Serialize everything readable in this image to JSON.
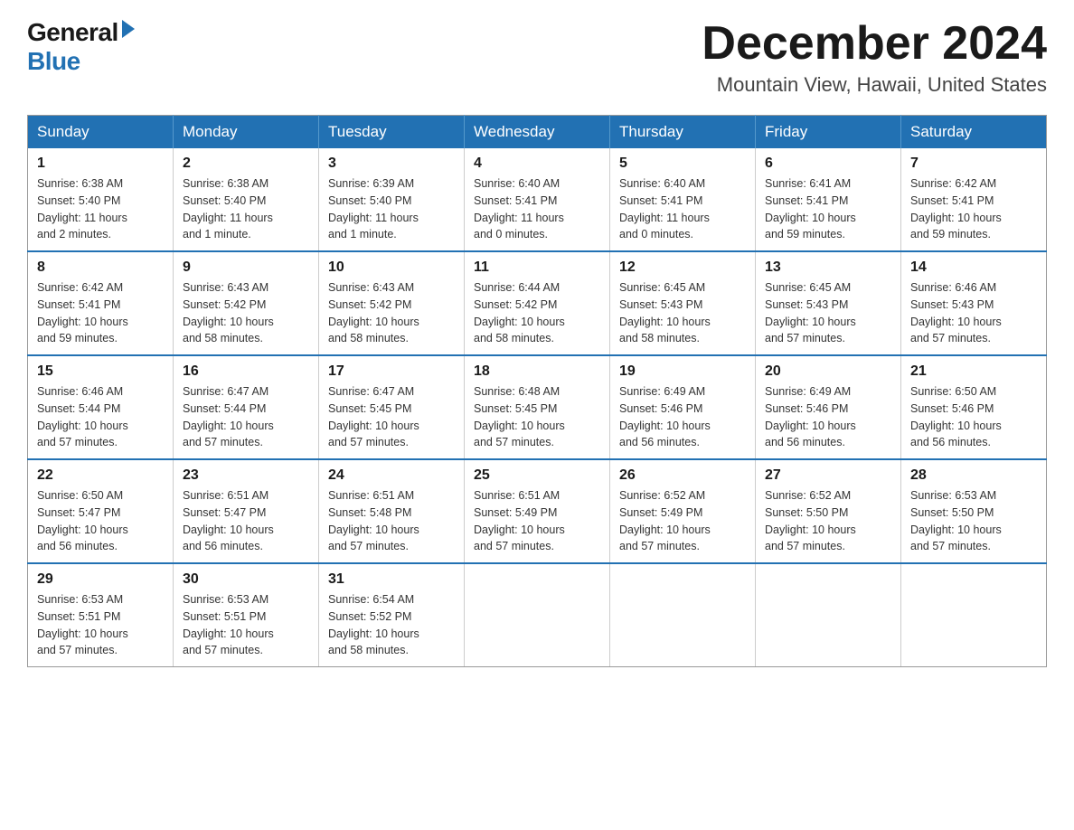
{
  "header": {
    "logo": {
      "general": "General",
      "blue": "Blue"
    },
    "title": "December 2024",
    "location": "Mountain View, Hawaii, United States"
  },
  "calendar": {
    "days_of_week": [
      "Sunday",
      "Monday",
      "Tuesday",
      "Wednesday",
      "Thursday",
      "Friday",
      "Saturday"
    ],
    "weeks": [
      [
        {
          "day": 1,
          "info": "Sunrise: 6:38 AM\nSunset: 5:40 PM\nDaylight: 11 hours\nand 2 minutes."
        },
        {
          "day": 2,
          "info": "Sunrise: 6:38 AM\nSunset: 5:40 PM\nDaylight: 11 hours\nand 1 minute."
        },
        {
          "day": 3,
          "info": "Sunrise: 6:39 AM\nSunset: 5:40 PM\nDaylight: 11 hours\nand 1 minute."
        },
        {
          "day": 4,
          "info": "Sunrise: 6:40 AM\nSunset: 5:41 PM\nDaylight: 11 hours\nand 0 minutes."
        },
        {
          "day": 5,
          "info": "Sunrise: 6:40 AM\nSunset: 5:41 PM\nDaylight: 11 hours\nand 0 minutes."
        },
        {
          "day": 6,
          "info": "Sunrise: 6:41 AM\nSunset: 5:41 PM\nDaylight: 10 hours\nand 59 minutes."
        },
        {
          "day": 7,
          "info": "Sunrise: 6:42 AM\nSunset: 5:41 PM\nDaylight: 10 hours\nand 59 minutes."
        }
      ],
      [
        {
          "day": 8,
          "info": "Sunrise: 6:42 AM\nSunset: 5:41 PM\nDaylight: 10 hours\nand 59 minutes."
        },
        {
          "day": 9,
          "info": "Sunrise: 6:43 AM\nSunset: 5:42 PM\nDaylight: 10 hours\nand 58 minutes."
        },
        {
          "day": 10,
          "info": "Sunrise: 6:43 AM\nSunset: 5:42 PM\nDaylight: 10 hours\nand 58 minutes."
        },
        {
          "day": 11,
          "info": "Sunrise: 6:44 AM\nSunset: 5:42 PM\nDaylight: 10 hours\nand 58 minutes."
        },
        {
          "day": 12,
          "info": "Sunrise: 6:45 AM\nSunset: 5:43 PM\nDaylight: 10 hours\nand 58 minutes."
        },
        {
          "day": 13,
          "info": "Sunrise: 6:45 AM\nSunset: 5:43 PM\nDaylight: 10 hours\nand 57 minutes."
        },
        {
          "day": 14,
          "info": "Sunrise: 6:46 AM\nSunset: 5:43 PM\nDaylight: 10 hours\nand 57 minutes."
        }
      ],
      [
        {
          "day": 15,
          "info": "Sunrise: 6:46 AM\nSunset: 5:44 PM\nDaylight: 10 hours\nand 57 minutes."
        },
        {
          "day": 16,
          "info": "Sunrise: 6:47 AM\nSunset: 5:44 PM\nDaylight: 10 hours\nand 57 minutes."
        },
        {
          "day": 17,
          "info": "Sunrise: 6:47 AM\nSunset: 5:45 PM\nDaylight: 10 hours\nand 57 minutes."
        },
        {
          "day": 18,
          "info": "Sunrise: 6:48 AM\nSunset: 5:45 PM\nDaylight: 10 hours\nand 57 minutes."
        },
        {
          "day": 19,
          "info": "Sunrise: 6:49 AM\nSunset: 5:46 PM\nDaylight: 10 hours\nand 56 minutes."
        },
        {
          "day": 20,
          "info": "Sunrise: 6:49 AM\nSunset: 5:46 PM\nDaylight: 10 hours\nand 56 minutes."
        },
        {
          "day": 21,
          "info": "Sunrise: 6:50 AM\nSunset: 5:46 PM\nDaylight: 10 hours\nand 56 minutes."
        }
      ],
      [
        {
          "day": 22,
          "info": "Sunrise: 6:50 AM\nSunset: 5:47 PM\nDaylight: 10 hours\nand 56 minutes."
        },
        {
          "day": 23,
          "info": "Sunrise: 6:51 AM\nSunset: 5:47 PM\nDaylight: 10 hours\nand 56 minutes."
        },
        {
          "day": 24,
          "info": "Sunrise: 6:51 AM\nSunset: 5:48 PM\nDaylight: 10 hours\nand 57 minutes."
        },
        {
          "day": 25,
          "info": "Sunrise: 6:51 AM\nSunset: 5:49 PM\nDaylight: 10 hours\nand 57 minutes."
        },
        {
          "day": 26,
          "info": "Sunrise: 6:52 AM\nSunset: 5:49 PM\nDaylight: 10 hours\nand 57 minutes."
        },
        {
          "day": 27,
          "info": "Sunrise: 6:52 AM\nSunset: 5:50 PM\nDaylight: 10 hours\nand 57 minutes."
        },
        {
          "day": 28,
          "info": "Sunrise: 6:53 AM\nSunset: 5:50 PM\nDaylight: 10 hours\nand 57 minutes."
        }
      ],
      [
        {
          "day": 29,
          "info": "Sunrise: 6:53 AM\nSunset: 5:51 PM\nDaylight: 10 hours\nand 57 minutes."
        },
        {
          "day": 30,
          "info": "Sunrise: 6:53 AM\nSunset: 5:51 PM\nDaylight: 10 hours\nand 57 minutes."
        },
        {
          "day": 31,
          "info": "Sunrise: 6:54 AM\nSunset: 5:52 PM\nDaylight: 10 hours\nand 58 minutes."
        },
        null,
        null,
        null,
        null
      ]
    ]
  }
}
